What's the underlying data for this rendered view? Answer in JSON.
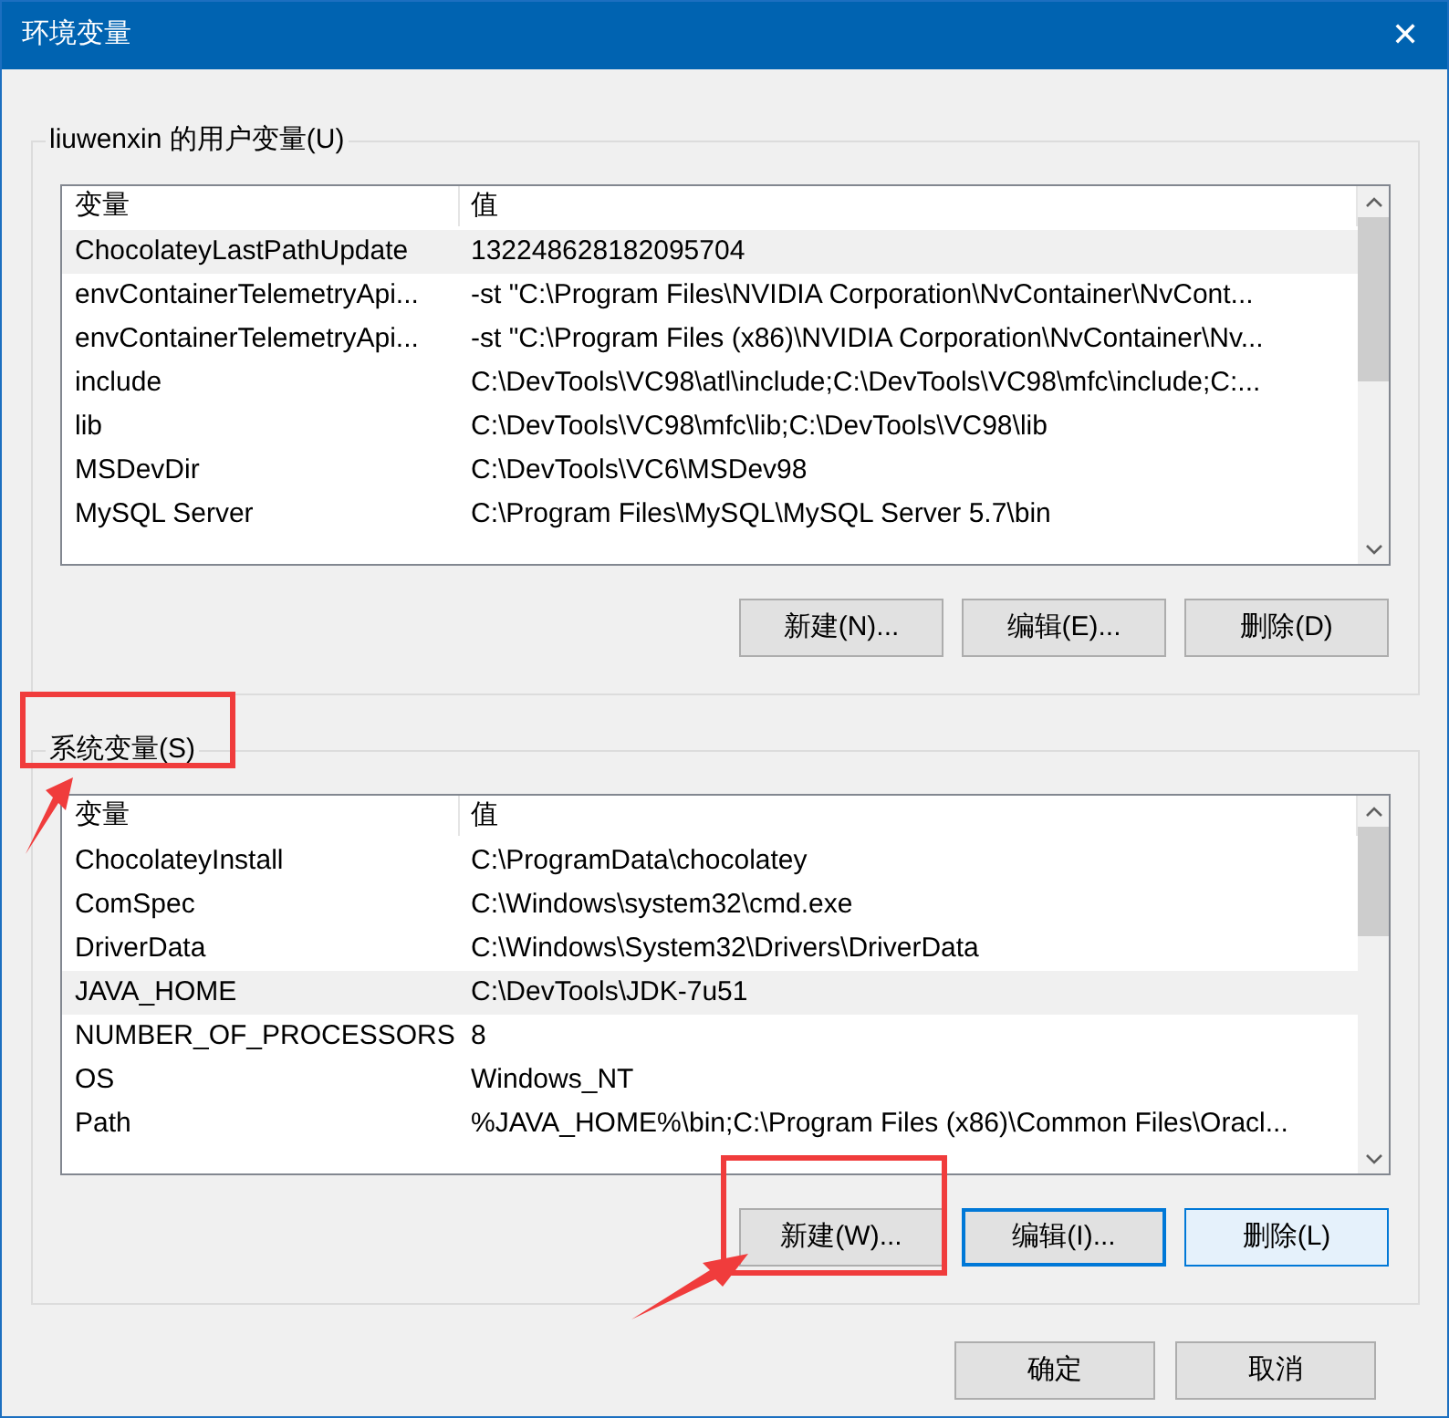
{
  "window": {
    "title": "环境变量",
    "close": "✕"
  },
  "groups": [
    {
      "label": "liuwenxin 的用户变量(U)",
      "columns": [
        "变量",
        "值"
      ],
      "rows": [
        {
          "name": "ChocolateyLastPathUpdate",
          "value": "132248628182095704",
          "selected": true
        },
        {
          "name": "envContainerTelemetryApi...",
          "value": "-st \"C:\\Program Files\\NVIDIA Corporation\\NvContainer\\NvCont...",
          "selected": false
        },
        {
          "name": "envContainerTelemetryApi...",
          "value": "-st \"C:\\Program Files (x86)\\NVIDIA Corporation\\NvContainer\\Nv...",
          "selected": false
        },
        {
          "name": "include",
          "value": "C:\\DevTools\\VC98\\atl\\include;C:\\DevTools\\VC98\\mfc\\include;C:...",
          "selected": false
        },
        {
          "name": "lib",
          "value": "C:\\DevTools\\VC98\\mfc\\lib;C:\\DevTools\\VC98\\lib",
          "selected": false
        },
        {
          "name": "MSDevDir",
          "value": "C:\\DevTools\\VC6\\MSDev98",
          "selected": false
        },
        {
          "name": "MySQL Server",
          "value": "C:\\Program Files\\MySQL\\MySQL Server 5.7\\bin",
          "selected": false
        }
      ],
      "buttons": [
        {
          "label": "新建(N)...",
          "focused": false,
          "hovered": false
        },
        {
          "label": "编辑(E)...",
          "focused": false,
          "hovered": false
        },
        {
          "label": "删除(D)",
          "focused": false,
          "hovered": false
        }
      ]
    },
    {
      "label": "系统变量(S)",
      "columns": [
        "变量",
        "值"
      ],
      "rows": [
        {
          "name": "ChocolateyInstall",
          "value": "C:\\ProgramData\\chocolatey",
          "selected": false
        },
        {
          "name": "ComSpec",
          "value": "C:\\Windows\\system32\\cmd.exe",
          "selected": false
        },
        {
          "name": "DriverData",
          "value": "C:\\Windows\\System32\\Drivers\\DriverData",
          "selected": false
        },
        {
          "name": "JAVA_HOME",
          "value": "C:\\DevTools\\JDK-7u51",
          "selected": true
        },
        {
          "name": "NUMBER_OF_PROCESSORS",
          "value": "8",
          "selected": false
        },
        {
          "name": "OS",
          "value": "Windows_NT",
          "selected": false
        },
        {
          "name": "Path",
          "value": "%JAVA_HOME%\\bin;C:\\Program Files (x86)\\Common Files\\Oracl...",
          "selected": false
        }
      ],
      "buttons": [
        {
          "label": "新建(W)...",
          "focused": false,
          "hovered": false
        },
        {
          "label": "编辑(I)...",
          "focused": true,
          "hovered": false
        },
        {
          "label": "删除(L)",
          "focused": false,
          "hovered": true
        }
      ]
    }
  ],
  "footer_buttons": [
    "确定",
    "取消"
  ]
}
